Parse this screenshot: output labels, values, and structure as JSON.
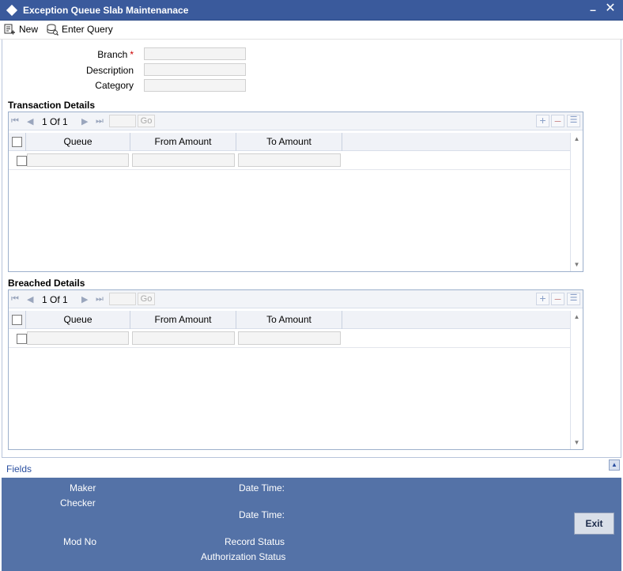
{
  "window": {
    "title": "Exception Queue Slab Maintenanace"
  },
  "toolbar": {
    "new_label": "New",
    "enter_query_label": "Enter Query"
  },
  "form": {
    "branch_label": "Branch",
    "required_mark": "*",
    "description_label": "Description",
    "category_label": "Category"
  },
  "transaction_details": {
    "title": "Transaction Details",
    "page_current": "1",
    "page_of": "Of",
    "page_total": "1",
    "go_label": "Go",
    "columns": [
      "Queue",
      "From Amount",
      "To Amount"
    ]
  },
  "breached_details": {
    "title": "Breached Details",
    "page_current": "1",
    "page_of": "Of",
    "page_total": "1",
    "go_label": "Go",
    "columns": [
      "Queue",
      "From Amount",
      "To Amount"
    ]
  },
  "fields_link": "Fields",
  "footer": {
    "maker": "Maker",
    "checker": "Checker",
    "date_time_1": "Date Time:",
    "date_time_2": "Date Time:",
    "mod_no": "Mod No",
    "record_status": "Record Status",
    "authorization_status": "Authorization Status",
    "exit_label": "Exit"
  },
  "colors": {
    "title_bar": "#3a5a9c",
    "footer": "#5472a7",
    "required": "#cc0000",
    "link": "#2a4fa0"
  }
}
